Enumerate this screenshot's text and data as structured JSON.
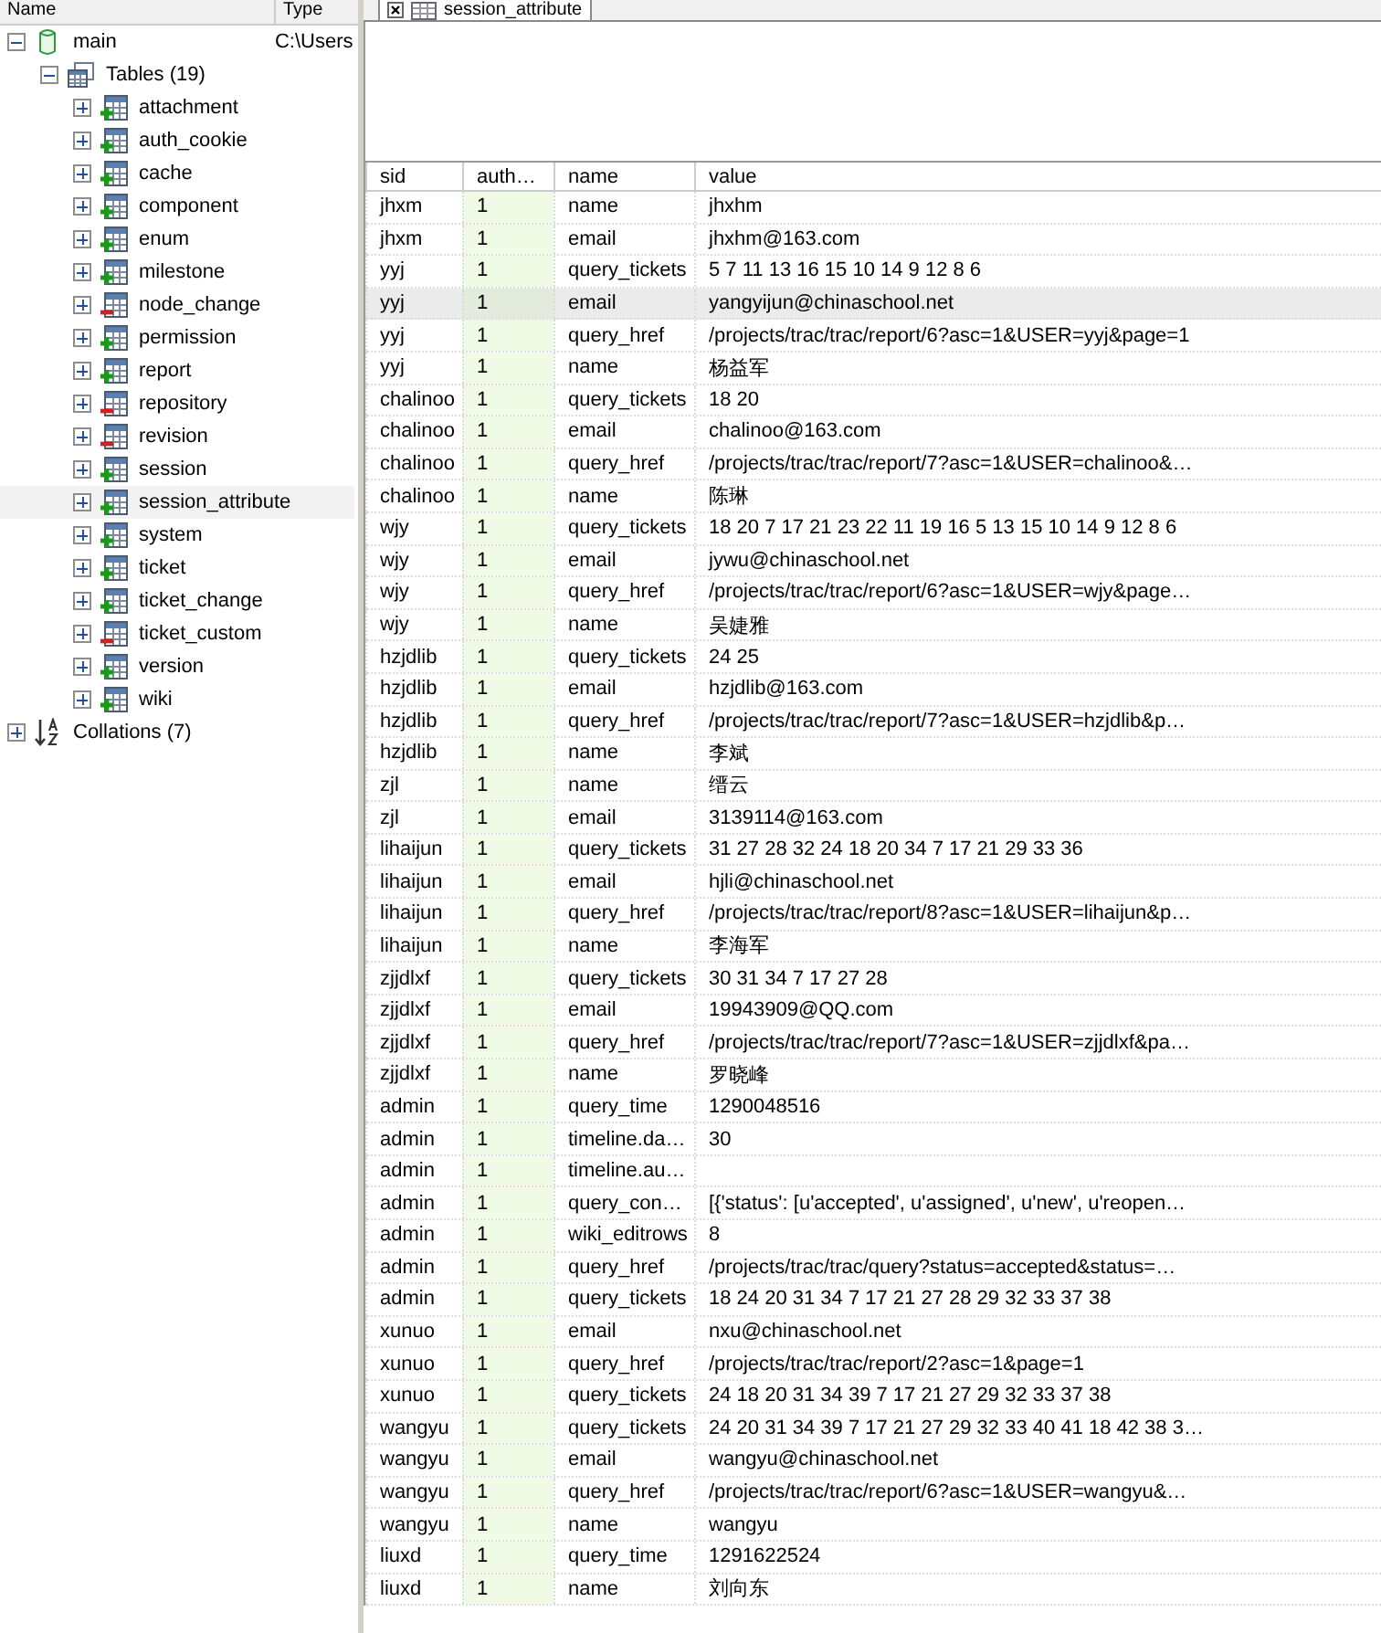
{
  "tree": {
    "columns": [
      "Name",
      "Type"
    ],
    "nodes": [
      {
        "kind": "database",
        "label": "main",
        "type": "C:\\Users",
        "expanded": true,
        "selected": false,
        "children": [
          {
            "kind": "folder",
            "label": "Tables (19)",
            "expanded": true,
            "selected": false,
            "children": [
              {
                "kind": "tableplus",
                "label": "attachment",
                "expanded": false,
                "selected": false
              },
              {
                "kind": "tableplus",
                "label": "auth_cookie",
                "expanded": false,
                "selected": false
              },
              {
                "kind": "tableplus",
                "label": "cache",
                "expanded": false,
                "selected": false
              },
              {
                "kind": "tableplus",
                "label": "component",
                "expanded": false,
                "selected": false
              },
              {
                "kind": "tableplus",
                "label": "enum",
                "expanded": false,
                "selected": false
              },
              {
                "kind": "tableplus",
                "label": "milestone",
                "expanded": false,
                "selected": false
              },
              {
                "kind": "tableminus",
                "label": "node_change",
                "expanded": false,
                "selected": false
              },
              {
                "kind": "tableplus",
                "label": "permission",
                "expanded": false,
                "selected": false
              },
              {
                "kind": "tableplus",
                "label": "report",
                "expanded": false,
                "selected": false
              },
              {
                "kind": "tableminus",
                "label": "repository",
                "expanded": false,
                "selected": false
              },
              {
                "kind": "tableminus",
                "label": "revision",
                "expanded": false,
                "selected": false
              },
              {
                "kind": "tableplus",
                "label": "session",
                "expanded": false,
                "selected": false
              },
              {
                "kind": "tableplus",
                "label": "session_attribute",
                "expanded": false,
                "selected": true
              },
              {
                "kind": "tableplus",
                "label": "system",
                "expanded": false,
                "selected": false
              },
              {
                "kind": "tableplus",
                "label": "ticket",
                "expanded": false,
                "selected": false
              },
              {
                "kind": "tableplus",
                "label": "ticket_change",
                "expanded": false,
                "selected": false
              },
              {
                "kind": "tableminus",
                "label": "ticket_custom",
                "expanded": false,
                "selected": false
              },
              {
                "kind": "tableplus",
                "label": "version",
                "expanded": false,
                "selected": false
              },
              {
                "kind": "tableplus",
                "label": "wiki",
                "expanded": false,
                "selected": false
              }
            ]
          }
        ]
      },
      {
        "kind": "collation",
        "label": "Collations (7)",
        "expanded": false,
        "selected": false
      }
    ]
  },
  "tab": {
    "label": "session_attribute"
  },
  "grid": {
    "columns": [
      "sid",
      "auth…",
      "name",
      "value"
    ],
    "rows": [
      {
        "cells": [
          "jhxm",
          "1",
          "name",
          "jhxhm"
        ],
        "selected": false
      },
      {
        "cells": [
          "jhxm",
          "1",
          "email",
          "jhxhm@163.com"
        ],
        "selected": false
      },
      {
        "cells": [
          "yyj",
          "1",
          "query_tickets",
          "5 7 11 13 16 15 10 14 9 12 8 6"
        ],
        "selected": false
      },
      {
        "cells": [
          "yyj",
          "1",
          "email",
          "yangyijun@chinaschool.net"
        ],
        "selected": true
      },
      {
        "cells": [
          "yyj",
          "1",
          "query_href",
          "/projects/trac/trac/report/6?asc=1&USER=yyj&page=1"
        ],
        "selected": false
      },
      {
        "cells": [
          "yyj",
          "1",
          "name",
          "杨益军"
        ],
        "selected": false
      },
      {
        "cells": [
          "chalinoo",
          "1",
          "query_tickets",
          "18 20"
        ],
        "selected": false
      },
      {
        "cells": [
          "chalinoo",
          "1",
          "email",
          "chalinoo@163.com"
        ],
        "selected": false
      },
      {
        "cells": [
          "chalinoo",
          "1",
          "query_href",
          "/projects/trac/trac/report/7?asc=1&USER=chalinoo&…"
        ],
        "selected": false
      },
      {
        "cells": [
          "chalinoo",
          "1",
          "name",
          "陈琳"
        ],
        "selected": false
      },
      {
        "cells": [
          "wjy",
          "1",
          "query_tickets",
          "18 20 7 17 21 23 22 11 19 16 5 13 15 10 14 9 12 8 6"
        ],
        "selected": false
      },
      {
        "cells": [
          "wjy",
          "1",
          "email",
          "jywu@chinaschool.net"
        ],
        "selected": false
      },
      {
        "cells": [
          "wjy",
          "1",
          "query_href",
          "/projects/trac/trac/report/6?asc=1&USER=wjy&page…"
        ],
        "selected": false
      },
      {
        "cells": [
          "wjy",
          "1",
          "name",
          "吴婕雅"
        ],
        "selected": false
      },
      {
        "cells": [
          "hzjdlib",
          "1",
          "query_tickets",
          "24 25"
        ],
        "selected": false
      },
      {
        "cells": [
          "hzjdlib",
          "1",
          "email",
          "hzjdlib@163.com"
        ],
        "selected": false
      },
      {
        "cells": [
          "hzjdlib",
          "1",
          "query_href",
          "/projects/trac/trac/report/7?asc=1&USER=hzjdlib&p…"
        ],
        "selected": false
      },
      {
        "cells": [
          "hzjdlib",
          "1",
          "name",
          "李斌"
        ],
        "selected": false
      },
      {
        "cells": [
          "zjl",
          "1",
          "name",
          "缙云"
        ],
        "selected": false
      },
      {
        "cells": [
          "zjl",
          "1",
          "email",
          "3139114@163.com"
        ],
        "selected": false
      },
      {
        "cells": [
          "lihaijun",
          "1",
          "query_tickets",
          "31 27 28 32 24 18 20 34 7 17 21 29 33 36"
        ],
        "selected": false
      },
      {
        "cells": [
          "lihaijun",
          "1",
          "email",
          "hjli@chinaschool.net"
        ],
        "selected": false
      },
      {
        "cells": [
          "lihaijun",
          "1",
          "query_href",
          "/projects/trac/trac/report/8?asc=1&USER=lihaijun&p…"
        ],
        "selected": false
      },
      {
        "cells": [
          "lihaijun",
          "1",
          "name",
          "李海军"
        ],
        "selected": false
      },
      {
        "cells": [
          "zjjdlxf",
          "1",
          "query_tickets",
          "30 31 34 7 17 27 28"
        ],
        "selected": false
      },
      {
        "cells": [
          "zjjdlxf",
          "1",
          "email",
          "19943909@QQ.com"
        ],
        "selected": false
      },
      {
        "cells": [
          "zjjdlxf",
          "1",
          "query_href",
          "/projects/trac/trac/report/7?asc=1&USER=zjjdlxf&pa…"
        ],
        "selected": false
      },
      {
        "cells": [
          "zjjdlxf",
          "1",
          "name",
          "罗晓峰"
        ],
        "selected": false
      },
      {
        "cells": [
          "admin",
          "1",
          "query_time",
          "1290048516"
        ],
        "selected": false
      },
      {
        "cells": [
          "admin",
          "1",
          "timeline.da…",
          "30"
        ],
        "selected": false
      },
      {
        "cells": [
          "admin",
          "1",
          "timeline.au…"
        ],
        "selected": false
      },
      {
        "cells": [
          "admin",
          "1",
          "query_con…",
          "[{'status': [u'accepted', u'assigned', u'new', u'reopen…"
        ],
        "selected": false
      },
      {
        "cells": [
          "admin",
          "1",
          "wiki_editrows",
          "8"
        ],
        "selected": false
      },
      {
        "cells": [
          "admin",
          "1",
          "query_href",
          "/projects/trac/trac/query?status=accepted&status=…"
        ],
        "selected": false
      },
      {
        "cells": [
          "admin",
          "1",
          "query_tickets",
          "18 24 20 31 34 7 17 21 27 28 29 32 33 37 38"
        ],
        "selected": false
      },
      {
        "cells": [
          "xunuo",
          "1",
          "email",
          "nxu@chinaschool.net"
        ],
        "selected": false
      },
      {
        "cells": [
          "xunuo",
          "1",
          "query_href",
          "/projects/trac/trac/report/2?asc=1&page=1"
        ],
        "selected": false
      },
      {
        "cells": [
          "xunuo",
          "1",
          "query_tickets",
          "24 18 20 31 34 39 7 17 21 27 29 32 33 37 38"
        ],
        "selected": false
      },
      {
        "cells": [
          "wangyu",
          "1",
          "query_tickets",
          "24 20 31 34 39 7 17 21 27 29 32 33 40 41 18 42 38 3…"
        ],
        "selected": false
      },
      {
        "cells": [
          "wangyu",
          "1",
          "email",
          "wangyu@chinaschool.net"
        ],
        "selected": false
      },
      {
        "cells": [
          "wangyu",
          "1",
          "query_href",
          "/projects/trac/trac/report/6?asc=1&USER=wangyu&…"
        ],
        "selected": false
      },
      {
        "cells": [
          "wangyu",
          "1",
          "name",
          "wangyu"
        ],
        "selected": false
      },
      {
        "cells": [
          "liuxd",
          "1",
          "query_time",
          "1291622524"
        ],
        "selected": false
      },
      {
        "cells": [
          "liuxd",
          "1",
          "name",
          "刘向东"
        ],
        "selected": false
      }
    ]
  }
}
